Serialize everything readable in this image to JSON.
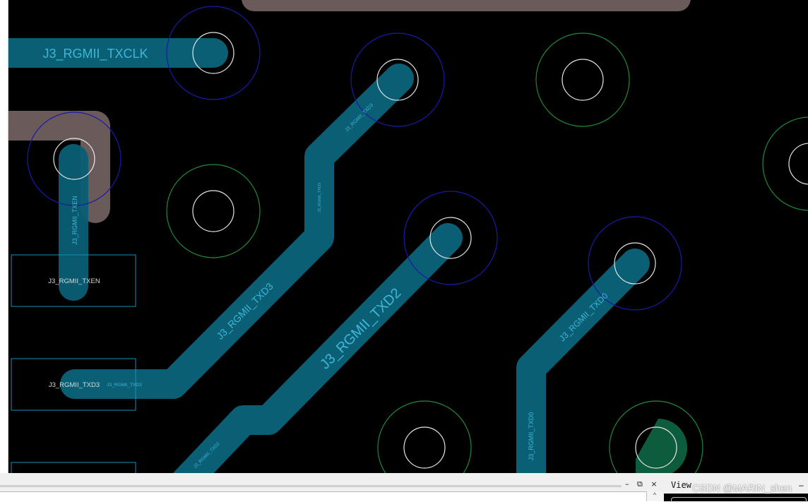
{
  "pcb": {
    "net_labels": {
      "txclk_big": "J3_RGMII_TXCLK",
      "txen_box": "J3_RGMII_TXEN",
      "txen_trace": "J3_RGMII_TXEN",
      "txd3_box": "J3_RGMII_TXD3",
      "txd3_box_overlay": "J3_RGMII_TXD3",
      "txd3_diag": "J3_RGMII_TXD3",
      "txd3_small": "J3_RGMII_TXD3",
      "txd3_vertical": "J3_RGMII_TXD3",
      "txd2_big": "J3_RGMII_TXD2",
      "txd2_small": "J3_RGMII_TXD2",
      "txd0_diag": "J3_RGMII_TXD0",
      "txd0_vertical": "J3_RGMII_TXD0"
    },
    "colors": {
      "background": "#000000",
      "trace_top": "#0a5f75",
      "trace_bottom": "#6b5a5a",
      "label_on_trace": "#3fb6d6",
      "via_ring_blue": "#1a1aa8",
      "via_ring_green": "#1f8a3a",
      "via_hole": "#e6e6e6",
      "filled_pad": "#0e5c3e",
      "component_outline": "#1c8fb0"
    }
  },
  "bottom_panel": {
    "controls": [
      "–",
      "⧉",
      "×"
    ],
    "view_label": "View",
    "view_minus": "–",
    "scroll_up": "^"
  },
  "watermark": "CSDN @MARIN_shen"
}
